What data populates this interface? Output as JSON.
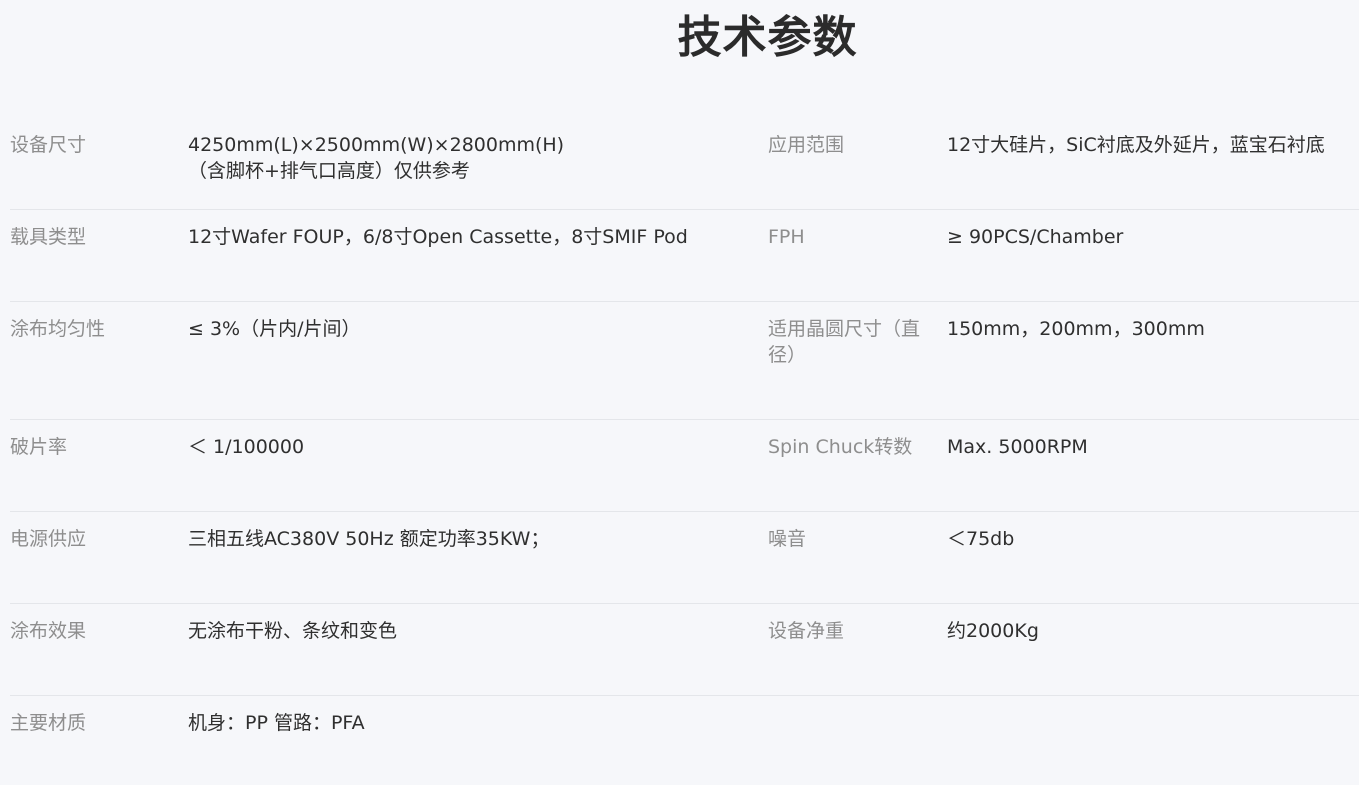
{
  "page": {
    "title": "技术参数"
  },
  "rows": [
    {
      "left_label": "设备尺寸",
      "left_value_line1": "4250mm(L)×2500mm(W)×2800mm(H)",
      "left_value_line2": "（含脚杯+排气口高度）仅供参考",
      "right_label": "应用范围",
      "right_value": "12寸大硅片，SiC衬底及外延片，蓝宝石衬底"
    },
    {
      "left_label": "载具类型",
      "left_value": "12寸Wafer FOUP，6/8寸Open Cassette，8寸SMIF Pod",
      "right_label": "FPH",
      "right_value": "≥ 90PCS/Chamber"
    },
    {
      "left_label": "涂布均匀性",
      "left_value": "≤ 3%（片内/片间）",
      "right_label_line1": "适用晶圆尺寸（直",
      "right_label_line2": "径）",
      "right_value": "150mm，200mm，300mm"
    },
    {
      "left_label": "破片率",
      "left_value": "＜ 1/100000",
      "right_label": "Spin Chuck转数",
      "right_value": "Max. 5000RPM"
    },
    {
      "left_label": "电源供应",
      "left_value": "三相五线AC380V 50Hz 额定功率35KW；",
      "right_label": "噪音",
      "right_value": "＜75db"
    },
    {
      "left_label": "涂布效果",
      "left_value": "无涂布干粉、条纹和变色",
      "right_label": "设备净重",
      "right_value": "约2000Kg"
    },
    {
      "left_label": "主要材质",
      "left_value": "机身：PP 管路：PFA"
    }
  ]
}
